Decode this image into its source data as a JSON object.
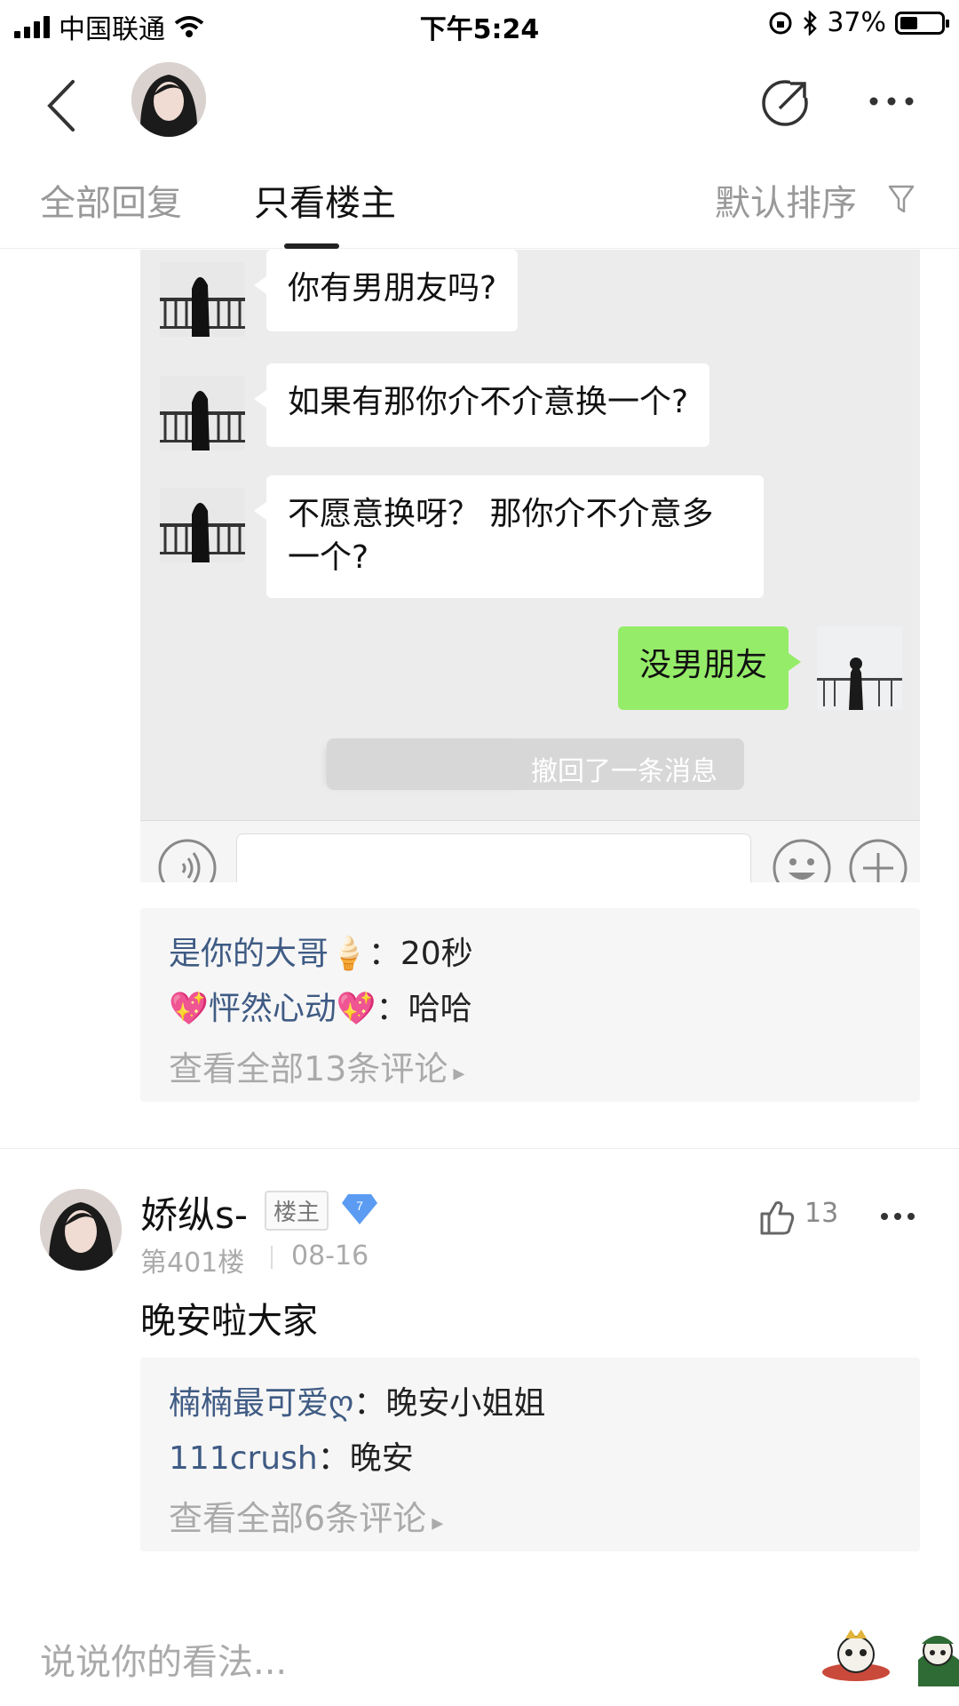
{
  "status_bar": {
    "carrier": "中国联通",
    "time": "下午5:24",
    "battery_text": "37%",
    "battery_level": 0.37
  },
  "tabs": {
    "all_replies": "全部回复",
    "op_only": "只看楼主",
    "sort": "默认排序"
  },
  "chat_screenshot": {
    "messages": [
      {
        "side": "left",
        "text": "你有男朋友吗?"
      },
      {
        "side": "left",
        "text": "如果有那你介不介意换一个?"
      },
      {
        "side": "left",
        "text": "不愿意换呀？ 那你介不介意多一个?"
      },
      {
        "side": "right",
        "text": "没男朋友"
      }
    ],
    "recall_notice": "撤回了一条消息"
  },
  "comments_1": {
    "items": [
      {
        "user": "是你的大哥🍦",
        "text": "：20秒"
      },
      {
        "user": "💖怦然心动💖",
        "text": "：哈哈"
      }
    ],
    "view_all": "查看全部13条评论"
  },
  "post": {
    "username": "娇纵s-",
    "op_badge": "楼主",
    "level": "7",
    "floor": "第401楼",
    "date": "08-16",
    "likes": "13",
    "content": "晚安啦大家"
  },
  "comments_2": {
    "items": [
      {
        "user": "楠楠最可爱ღ",
        "text": "：晚安小姐姐"
      },
      {
        "user": "111crush",
        "text": "：晚安"
      }
    ],
    "view_all": "查看全部6条评论"
  },
  "bottom_bar": {
    "placeholder": "说说你的看法..."
  },
  "colors": {
    "user_link": "#3f5b84",
    "mine_bubble": "#95ec69",
    "level_badge": "#5b9cf2"
  }
}
